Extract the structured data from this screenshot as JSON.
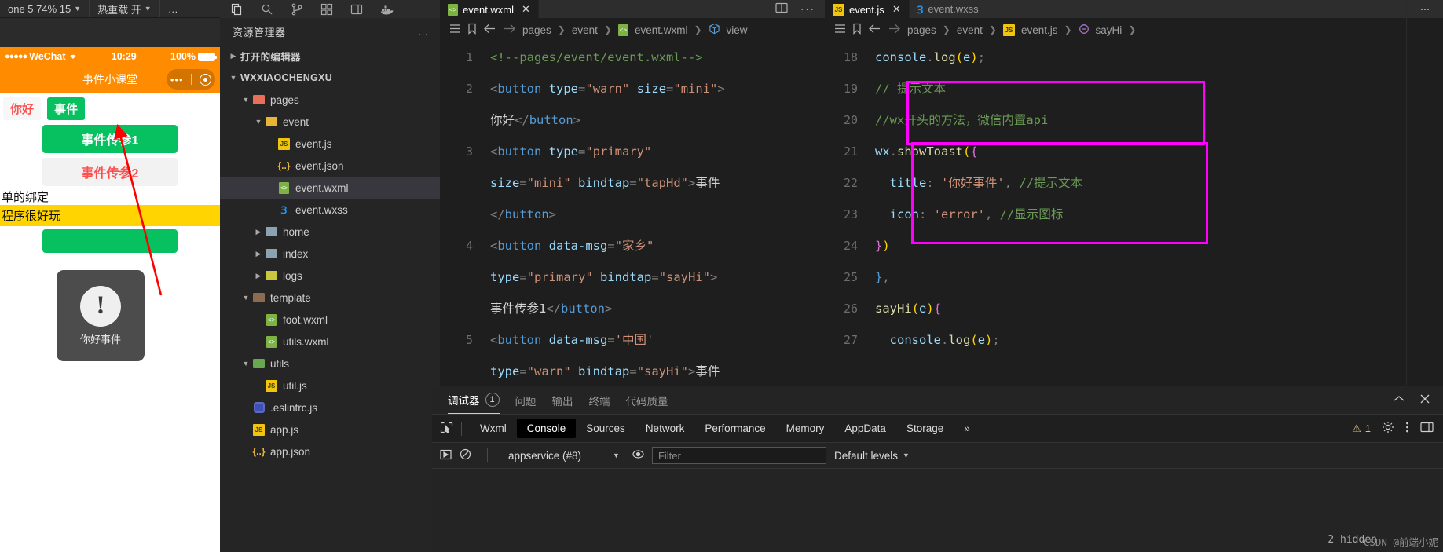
{
  "simulator": {
    "toolbar": [
      {
        "label": "one 5 74% 15",
        "name": "device-select"
      },
      {
        "label": "热重载 开",
        "name": "hotreload-select"
      },
      {
        "label": "…",
        "name": "more-options"
      }
    ],
    "status": {
      "carrier": "WeChat",
      "time": "10:29",
      "battery": "100%"
    },
    "nav_title": "事件小课堂",
    "buttons": {
      "hello": "你好",
      "event": "事件",
      "pass1": "事件传参1",
      "pass2": "事件传参2"
    },
    "text_lines": [
      "单的绑定",
      "程序很好玩"
    ],
    "toast": {
      "icon": "!",
      "label": "你好事件"
    }
  },
  "explorer": {
    "title": "资源管理器",
    "more": "…",
    "icons": [
      "files-icon",
      "search-icon",
      "source-control-icon",
      "extensions-icon",
      "layout-icon",
      "docker-icon"
    ],
    "tree": [
      {
        "label": "打开的编辑器",
        "indent": 0,
        "arrow": "▶",
        "icon": "none",
        "bold": true
      },
      {
        "label": "WXXIAOCHENGXU",
        "indent": 0,
        "arrow": "▼",
        "icon": "none",
        "bold": true
      },
      {
        "label": "pages",
        "indent": 1,
        "arrow": "▼",
        "icon": "folder-pages",
        "bold": false
      },
      {
        "label": "event",
        "indent": 2,
        "arrow": "▼",
        "icon": "folder-event",
        "bold": false
      },
      {
        "label": "event.js",
        "indent": 3,
        "arrow": "",
        "icon": "js",
        "bold": false
      },
      {
        "label": "event.json",
        "indent": 3,
        "arrow": "",
        "icon": "json",
        "bold": false
      },
      {
        "label": "event.wxml",
        "indent": 3,
        "arrow": "",
        "icon": "wxml",
        "bold": false,
        "selected": true
      },
      {
        "label": "event.wxss",
        "indent": 3,
        "arrow": "",
        "icon": "wxss",
        "bold": false
      },
      {
        "label": "home",
        "indent": 2,
        "arrow": "▶",
        "icon": "folder-plain",
        "bold": false
      },
      {
        "label": "index",
        "indent": 2,
        "arrow": "▶",
        "icon": "folder-plain",
        "bold": false
      },
      {
        "label": "logs",
        "indent": 2,
        "arrow": "▶",
        "icon": "folder-logs",
        "bold": false
      },
      {
        "label": "template",
        "indent": 1,
        "arrow": "▼",
        "icon": "folder-template",
        "bold": false
      },
      {
        "label": "foot.wxml",
        "indent": 2,
        "arrow": "",
        "icon": "wxml",
        "bold": false
      },
      {
        "label": "utils.wxml",
        "indent": 2,
        "arrow": "",
        "icon": "wxml",
        "bold": false
      },
      {
        "label": "utils",
        "indent": 1,
        "arrow": "▼",
        "icon": "folder-utils",
        "bold": false
      },
      {
        "label": "util.js",
        "indent": 2,
        "arrow": "",
        "icon": "js",
        "bold": false
      },
      {
        "label": ".eslintrc.js",
        "indent": 1,
        "arrow": "",
        "icon": "eslint",
        "bold": false
      },
      {
        "label": "app.js",
        "indent": 1,
        "arrow": "",
        "icon": "js",
        "bold": false
      },
      {
        "label": "app.json",
        "indent": 1,
        "arrow": "",
        "icon": "json",
        "bold": false
      }
    ]
  },
  "editor_wxml": {
    "tab": {
      "label": "event.wxml",
      "icon": "wxml-icon",
      "close": "✕"
    },
    "actions": [
      "split-editor-icon",
      "more-actions-icon"
    ],
    "breadcrumb": [
      "pages",
      "event",
      "event.wxml",
      "view"
    ],
    "toolbar_icons": [
      "outline-icon",
      "bookmark-icon",
      "back-arrow-icon",
      "forward-arrow-icon"
    ],
    "lines": [
      {
        "n": "1",
        "tokens": [
          {
            "t": "cmt",
            "s": "<!--pages/event/event.wxml-->"
          }
        ]
      },
      {
        "n": "2",
        "tokens": [
          {
            "t": "punc",
            "s": "<"
          },
          {
            "t": "tag",
            "s": "button"
          },
          {
            "t": "txt",
            "s": " "
          },
          {
            "t": "attr",
            "s": "type"
          },
          {
            "t": "punc",
            "s": "="
          },
          {
            "t": "str",
            "s": "\"warn\""
          },
          {
            "t": "txt",
            "s": " "
          },
          {
            "t": "attr",
            "s": "size"
          },
          {
            "t": "punc",
            "s": "="
          },
          {
            "t": "str",
            "s": "\"mini\""
          },
          {
            "t": "punc",
            "s": ">"
          }
        ]
      },
      {
        "n": "",
        "tokens": [
          {
            "t": "txt",
            "s": "你好"
          },
          {
            "t": "punc",
            "s": "</"
          },
          {
            "t": "tag",
            "s": "button"
          },
          {
            "t": "punc",
            "s": ">"
          }
        ]
      },
      {
        "n": "3",
        "tokens": [
          {
            "t": "punc",
            "s": "<"
          },
          {
            "t": "tag",
            "s": "button"
          },
          {
            "t": "txt",
            "s": " "
          },
          {
            "t": "attr",
            "s": "type"
          },
          {
            "t": "punc",
            "s": "="
          },
          {
            "t": "str",
            "s": "\"primary\""
          }
        ]
      },
      {
        "n": "",
        "tokens": [
          {
            "t": "attr",
            "s": "size"
          },
          {
            "t": "punc",
            "s": "="
          },
          {
            "t": "str",
            "s": "\"mini\""
          },
          {
            "t": "txt",
            "s": " "
          },
          {
            "t": "attr",
            "s": "bindtap"
          },
          {
            "t": "punc",
            "s": "="
          },
          {
            "t": "str",
            "s": "\"tapHd\""
          },
          {
            "t": "punc",
            "s": ">"
          },
          {
            "t": "txt",
            "s": "事件"
          }
        ]
      },
      {
        "n": "",
        "tokens": [
          {
            "t": "punc",
            "s": "</"
          },
          {
            "t": "tag",
            "s": "button"
          },
          {
            "t": "punc",
            "s": ">"
          }
        ]
      },
      {
        "n": "4",
        "tokens": [
          {
            "t": "punc",
            "s": "<"
          },
          {
            "t": "tag",
            "s": "button"
          },
          {
            "t": "txt",
            "s": " "
          },
          {
            "t": "attr",
            "s": "data-msg"
          },
          {
            "t": "punc",
            "s": "="
          },
          {
            "t": "str",
            "s": "\"家乡\""
          }
        ]
      },
      {
        "n": "",
        "tokens": [
          {
            "t": "attr",
            "s": "type"
          },
          {
            "t": "punc",
            "s": "="
          },
          {
            "t": "str",
            "s": "\"primary\""
          },
          {
            "t": "txt",
            "s": " "
          },
          {
            "t": "attr",
            "s": "bindtap"
          },
          {
            "t": "punc",
            "s": "="
          },
          {
            "t": "str",
            "s": "\"sayHi\""
          },
          {
            "t": "punc",
            "s": ">"
          }
        ]
      },
      {
        "n": "",
        "tokens": [
          {
            "t": "txt",
            "s": "事件传参1"
          },
          {
            "t": "punc",
            "s": "</"
          },
          {
            "t": "tag",
            "s": "button"
          },
          {
            "t": "punc",
            "s": ">"
          }
        ]
      },
      {
        "n": "5",
        "tokens": [
          {
            "t": "punc",
            "s": "<"
          },
          {
            "t": "tag",
            "s": "button"
          },
          {
            "t": "txt",
            "s": " "
          },
          {
            "t": "attr",
            "s": "data-msg"
          },
          {
            "t": "punc",
            "s": "="
          },
          {
            "t": "str",
            "s": "'中国'"
          }
        ]
      },
      {
        "n": "",
        "tokens": [
          {
            "t": "attr",
            "s": "type"
          },
          {
            "t": "punc",
            "s": "="
          },
          {
            "t": "str",
            "s": "\"warn\""
          },
          {
            "t": "txt",
            "s": " "
          },
          {
            "t": "attr",
            "s": "bindtap"
          },
          {
            "t": "punc",
            "s": "="
          },
          {
            "t": "str",
            "s": "\"sayHi\""
          },
          {
            "t": "punc",
            "s": ">"
          },
          {
            "t": "txt",
            "s": "事件"
          }
        ]
      }
    ]
  },
  "editor_js": {
    "tabs": [
      {
        "label": "event.js",
        "icon": "js-icon",
        "active": true,
        "close": "✕"
      },
      {
        "label": "event.wxss",
        "icon": "wxss-icon",
        "active": false,
        "close": ""
      }
    ],
    "actions": [
      "more-actions-icon"
    ],
    "breadcrumb": [
      "pages",
      "event",
      "event.js",
      "sayHi"
    ],
    "toolbar_icons": [
      "outline-icon",
      "bookmark-icon",
      "back-arrow-icon",
      "forward-arrow-icon"
    ],
    "lines": [
      {
        "n": "18",
        "tokens": [
          {
            "t": "obj",
            "s": "console"
          },
          {
            "t": "punc",
            "s": "."
          },
          {
            "t": "fn",
            "s": "log"
          },
          {
            "t": "par",
            "s": "("
          },
          {
            "t": "obj",
            "s": "e"
          },
          {
            "t": "par",
            "s": ")"
          },
          {
            "t": "punc",
            "s": ";"
          }
        ]
      },
      {
        "n": "19",
        "tokens": [
          {
            "t": "cmt",
            "s": "// 提示文本"
          }
        ]
      },
      {
        "n": "20",
        "tokens": [
          {
            "t": "cmt",
            "s": "//wx开头的方法，微信内置api"
          }
        ]
      },
      {
        "n": "21",
        "tokens": [
          {
            "t": "obj",
            "s": "wx"
          },
          {
            "t": "punc",
            "s": "."
          },
          {
            "t": "fn",
            "s": "showToast"
          },
          {
            "t": "par",
            "s": "("
          },
          {
            "t": "par2",
            "s": "{"
          }
        ]
      },
      {
        "n": "22",
        "tokens": [
          {
            "t": "txt",
            "s": "  "
          },
          {
            "t": "obj",
            "s": "title"
          },
          {
            "t": "punc",
            "s": ": "
          },
          {
            "t": "str",
            "s": "'你好事件'"
          },
          {
            "t": "punc",
            "s": ", "
          },
          {
            "t": "cmt",
            "s": "//提示文本"
          }
        ]
      },
      {
        "n": "23",
        "tokens": [
          {
            "t": "txt",
            "s": "  "
          },
          {
            "t": "obj",
            "s": "icon"
          },
          {
            "t": "punc",
            "s": ": "
          },
          {
            "t": "str",
            "s": "'error'"
          },
          {
            "t": "punc",
            "s": ", "
          },
          {
            "t": "cmt",
            "s": "//显示图标"
          }
        ]
      },
      {
        "n": "24",
        "tokens": [
          {
            "t": "par2",
            "s": "}"
          },
          {
            "t": "par",
            "s": ")"
          }
        ]
      },
      {
        "n": "25",
        "tokens": [
          {
            "t": "tag",
            "s": "}"
          },
          {
            "t": "punc",
            "s": ","
          }
        ]
      },
      {
        "n": "26",
        "tokens": [
          {
            "t": "fn",
            "s": "sayHi"
          },
          {
            "t": "par",
            "s": "("
          },
          {
            "t": "obj",
            "s": "e"
          },
          {
            "t": "par",
            "s": ")"
          },
          {
            "t": "par2",
            "s": "{"
          }
        ]
      },
      {
        "n": "27",
        "tokens": [
          {
            "t": "txt",
            "s": "  "
          },
          {
            "t": "obj",
            "s": "console"
          },
          {
            "t": "punc",
            "s": "."
          },
          {
            "t": "fn",
            "s": "log"
          },
          {
            "t": "par",
            "s": "("
          },
          {
            "t": "obj",
            "s": "e"
          },
          {
            "t": "par",
            "s": ")"
          },
          {
            "t": "punc",
            "s": ";"
          }
        ]
      }
    ]
  },
  "devtools": {
    "panel_tabs": [
      {
        "label": "调试器",
        "count": "1",
        "active": true
      },
      {
        "label": "问题",
        "count": "",
        "active": false
      },
      {
        "label": "输出",
        "count": "",
        "active": false
      },
      {
        "label": "终端",
        "count": "",
        "active": false
      },
      {
        "label": "代码质量",
        "count": "",
        "active": false
      }
    ],
    "panel_actions": [
      "chevron-up-icon",
      "close-icon"
    ],
    "inspect_icon": "inspect-element-icon",
    "tabs": [
      "Wxml",
      "Console",
      "Sources",
      "Network",
      "Performance",
      "Memory",
      "AppData",
      "Storage"
    ],
    "active_tab": "Console",
    "overflow": "»",
    "warning_count": "1",
    "right_icons": [
      "settings-gear-icon",
      "kebab-menu-icon",
      "dock-side-icon"
    ],
    "console_bar": {
      "execute_icon": "execution-context-icon",
      "clear_icon": "clear-console-icon",
      "context": "appservice (#8)",
      "eye_icon": "live-expression-icon",
      "filter_placeholder": "Filter",
      "levels": "Default levels"
    },
    "hidden_note": "2 hidden",
    "watermark": "CSDN @前端小妮"
  },
  "colors": {
    "accent_orange": "#ff8c00",
    "wechat_green": "#07c160",
    "warn_red": "#fa5151",
    "annotation_magenta": "#ff00ff",
    "highlight_yellow": "#ffd400"
  }
}
